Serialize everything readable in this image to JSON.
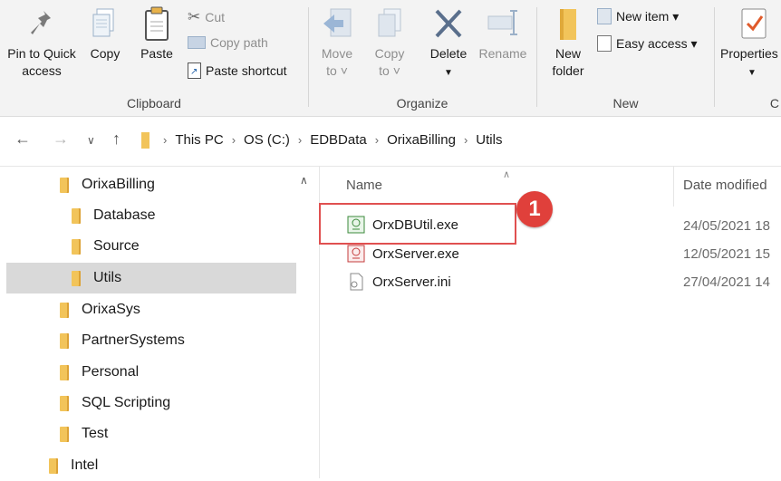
{
  "ribbon": {
    "clipboard": {
      "group_label": "Clipboard",
      "pin_label": "Pin to Quick\naccess",
      "copy_label": "Copy",
      "paste_label": "Paste",
      "cut_label": "Cut",
      "copy_path_label": "Copy path",
      "paste_shortcut_label": "Paste shortcut"
    },
    "organize": {
      "group_label": "Organize",
      "move_to_label": "Move\nto ˅",
      "copy_to_label": "Copy\nto ˅",
      "delete_label": "Delete",
      "rename_label": "Rename"
    },
    "new": {
      "group_label": "New",
      "new_folder_label": "New\nfolder",
      "new_item_label": "New item ▾",
      "easy_access_label": "Easy access ▾"
    },
    "open": {
      "properties_label": "Properties",
      "partial_group_label": "C"
    }
  },
  "address": {
    "crumbs": [
      "This PC",
      "OS (C:)",
      "EDBData",
      "OrixaBilling",
      "Utils"
    ]
  },
  "tree": {
    "items": [
      {
        "label": "OrixaBilling"
      },
      {
        "label": "Database"
      },
      {
        "label": "Source"
      },
      {
        "label": "Utils"
      },
      {
        "label": "OrixaSys"
      },
      {
        "label": "PartnerSystems"
      },
      {
        "label": "Personal"
      },
      {
        "label": "SQL Scripting"
      },
      {
        "label": "Test"
      },
      {
        "label": "Intel"
      }
    ]
  },
  "files": {
    "col_name": "Name",
    "col_date": "Date modified",
    "rows": [
      {
        "name": "OrxDBUtil.exe",
        "date": "24/05/2021 18"
      },
      {
        "name": "OrxServer.exe",
        "date": "12/05/2021 15"
      },
      {
        "name": "OrxServer.ini",
        "date": "27/04/2021 14"
      }
    ]
  },
  "annotation": {
    "badge": "1"
  },
  "colors": {
    "highlight": "#e05050",
    "badge": "#e0403b",
    "folder": "#f2c45a"
  }
}
